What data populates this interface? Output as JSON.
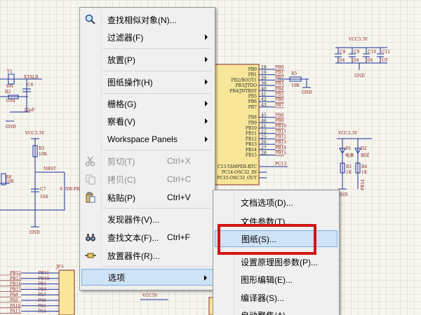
{
  "main_menu": {
    "items": [
      {
        "label": "查找相似对象(N)...",
        "icon": "find-similar-icon",
        "shortcut": "",
        "submenu": false,
        "disabled": false
      },
      {
        "label": "过滤器(F)",
        "icon": "",
        "shortcut": "",
        "submenu": true,
        "disabled": false
      },
      {
        "label": "放置(P)",
        "icon": "",
        "shortcut": "",
        "submenu": true,
        "disabled": false
      },
      {
        "label": "图纸操作(H)",
        "icon": "",
        "shortcut": "",
        "submenu": true,
        "disabled": false
      },
      {
        "label": "栅格(G)",
        "icon": "",
        "shortcut": "",
        "submenu": true,
        "disabled": false
      },
      {
        "label": "察看(V)",
        "icon": "",
        "shortcut": "",
        "submenu": true,
        "disabled": false
      },
      {
        "label": "Workspace Panels",
        "icon": "",
        "shortcut": "",
        "submenu": true,
        "disabled": false
      },
      {
        "label": "剪切(T)",
        "icon": "scissors-icon",
        "shortcut": "Ctrl+X",
        "submenu": false,
        "disabled": true
      },
      {
        "label": "拷贝(C)",
        "icon": "copy-icon",
        "shortcut": "Ctrl+C",
        "submenu": false,
        "disabled": true
      },
      {
        "label": "粘贴(P)",
        "icon": "paste-icon",
        "shortcut": "Ctrl+V",
        "submenu": false,
        "disabled": false
      },
      {
        "label": "发现器件(V)...",
        "icon": "",
        "shortcut": "",
        "submenu": false,
        "disabled": false
      },
      {
        "label": "查找文本(F)...",
        "icon": "binoculars-icon",
        "shortcut": "Ctrl+F",
        "submenu": false,
        "disabled": false
      },
      {
        "label": "放置器件(R)...",
        "icon": "place-part-icon",
        "shortcut": "",
        "submenu": false,
        "disabled": false
      },
      {
        "label": "选项",
        "icon": "",
        "shortcut": "",
        "submenu": true,
        "disabled": false,
        "active": true
      }
    ]
  },
  "sub_menu": {
    "items": [
      {
        "label": "文档选项(D)..."
      },
      {
        "label": "文件参数(T)..."
      },
      {
        "label": "图纸(S)...",
        "active": true
      },
      {
        "label": "设置原理图参数(P)..."
      },
      {
        "label": "图形编辑(E)..."
      },
      {
        "label": "编译器(S)..."
      },
      {
        "label": "自动聚焦(A)..."
      }
    ]
  },
  "schematic": {
    "mcu_pins_right": [
      "PB0",
      "PB1",
      "PB2/BOOT1",
      "PB3/JTDO",
      "PB4/JNTRST",
      "PB5",
      "PB6",
      "PB7",
      "PB8",
      "PB9",
      "PB10",
      "PB11",
      "PB12",
      "PB13",
      "PB14",
      "PB15"
    ],
    "mcu_pins_left": [
      "C13-TAMPER-RTC",
      "PC14-OSC32_IN",
      "PC15-OSC32_OUT"
    ],
    "mcu_pin_numbers": [
      "18",
      "19",
      "20",
      "39",
      "40",
      "41",
      "42",
      "43",
      "45",
      "46",
      "21",
      "22",
      "25",
      "26",
      "27",
      "28"
    ],
    "net_labels_right": [
      "PB0",
      "PB1",
      "PB2",
      "PB3",
      "PB4",
      "PB5",
      "PB6",
      "PB7",
      "PB8",
      "PB9",
      "PB10",
      "PB11",
      "PB12",
      "PB13",
      "PB14",
      "PB15"
    ],
    "net_pc13": "PC13",
    "r5": {
      "ref": "R5",
      "value": "10K"
    },
    "vcc_top_right": "VCC3.3V",
    "caps": [
      {
        "ref": "C8",
        "value": "104"
      },
      {
        "ref": "C9",
        "value": "104"
      },
      {
        "ref": "C10",
        "value": "104"
      },
      {
        "ref": "C11",
        "value": "1UF"
      }
    ],
    "gnd": "GND",
    "vcc_leds": "VCC3.3V",
    "leds": [
      {
        "ref": "D1",
        "label": "电源"
      },
      {
        "ref": "D2",
        "label": "测试"
      }
    ],
    "led_resistors": [
      {
        "ref": "R1",
        "value": "1K"
      },
      {
        "ref": "R4",
        "value": "1K"
      }
    ],
    "led_net": "PB14",
    "left_parts": {
      "y1": "Y1",
      "xtal": "XTALB",
      "freq": "8M",
      "r2": "R2",
      "r2v": "10M",
      "c6": "C6",
      "c6v": "22pF",
      "vcc": "VCC3.3V",
      "r3": "R3",
      "r3v": "10K",
      "r8": "R8",
      "r8v": "10K",
      "nrst": "NRST",
      "c7": "C7",
      "c7v": "104",
      "sw": "SW-PB",
      "s": "S"
    },
    "jp3": "JP3",
    "jp_pins_left": [
      "PB12",
      "PB13",
      "PB14",
      "PB15",
      "PA8",
      "PA9",
      "PA10",
      "PA11"
    ],
    "jp_pins_right": [
      "PB11",
      "PB10",
      "PB1",
      "PB0",
      "PA7",
      "PA6",
      "PA5",
      "PA4"
    ],
    "vcc5v": "VCC5V"
  }
}
